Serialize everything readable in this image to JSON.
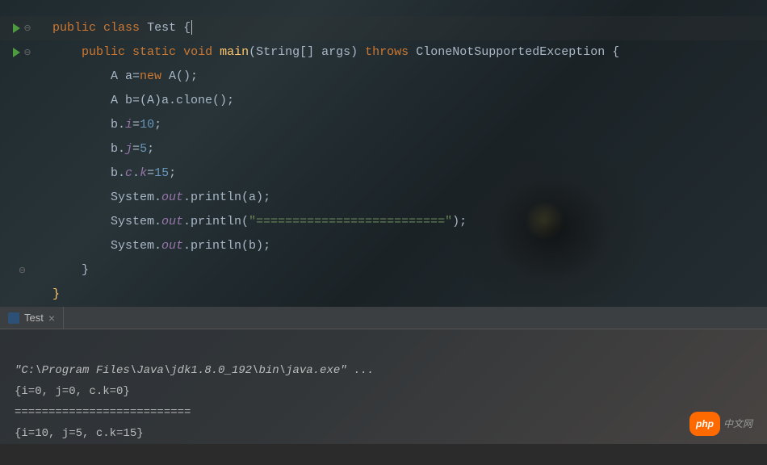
{
  "code": {
    "l1_public": "public",
    "l1_class": "class",
    "l1_name": "Test",
    "l1_brace": "{",
    "l2_public": "public",
    "l2_static": "static",
    "l2_void": "void",
    "l2_main": "main",
    "l2_params": "(String[] args)",
    "l2_throws": "throws",
    "l2_exc": "CloneNotSupportedException",
    "l2_brace": "{",
    "l3_a": "A a=",
    "l3_new": "new",
    "l3_call": " A();",
    "l4": "A b=(A)a.clone();",
    "l5_pre": "b.",
    "l5_field": "i",
    "l5_eq": "=",
    "l5_num": "10",
    "l5_semi": ";",
    "l6_pre": "b.",
    "l6_field": "j",
    "l6_eq": "=",
    "l6_num": "5",
    "l6_semi": ";",
    "l7_pre": "b.",
    "l7_f1": "c",
    "l7_dot": ".",
    "l7_f2": "k",
    "l7_eq": "=",
    "l7_num": "15",
    "l7_semi": ";",
    "l8_sys": "System.",
    "l8_out": "out",
    "l8_call": ".println(a);",
    "l9_sys": "System.",
    "l9_out": "out",
    "l9_call1": ".println(",
    "l9_str": "\"==========================\"",
    "l9_call2": ");",
    "l10_sys": "System.",
    "l10_out": "out",
    "l10_call": ".println(b);",
    "l11_brace": "}",
    "l12_brace": "}"
  },
  "tab": {
    "label": "Test",
    "close": "×"
  },
  "console": {
    "cmd": "\"C:\\Program Files\\Java\\jdk1.8.0_192\\bin\\java.exe\" ...",
    "out1": "{i=0, j=0, c.k=0}",
    "out2": "==========================",
    "out3": "{i=10, j=5, c.k=15}"
  },
  "watermark": {
    "brand": "php",
    "text": "中文网"
  }
}
